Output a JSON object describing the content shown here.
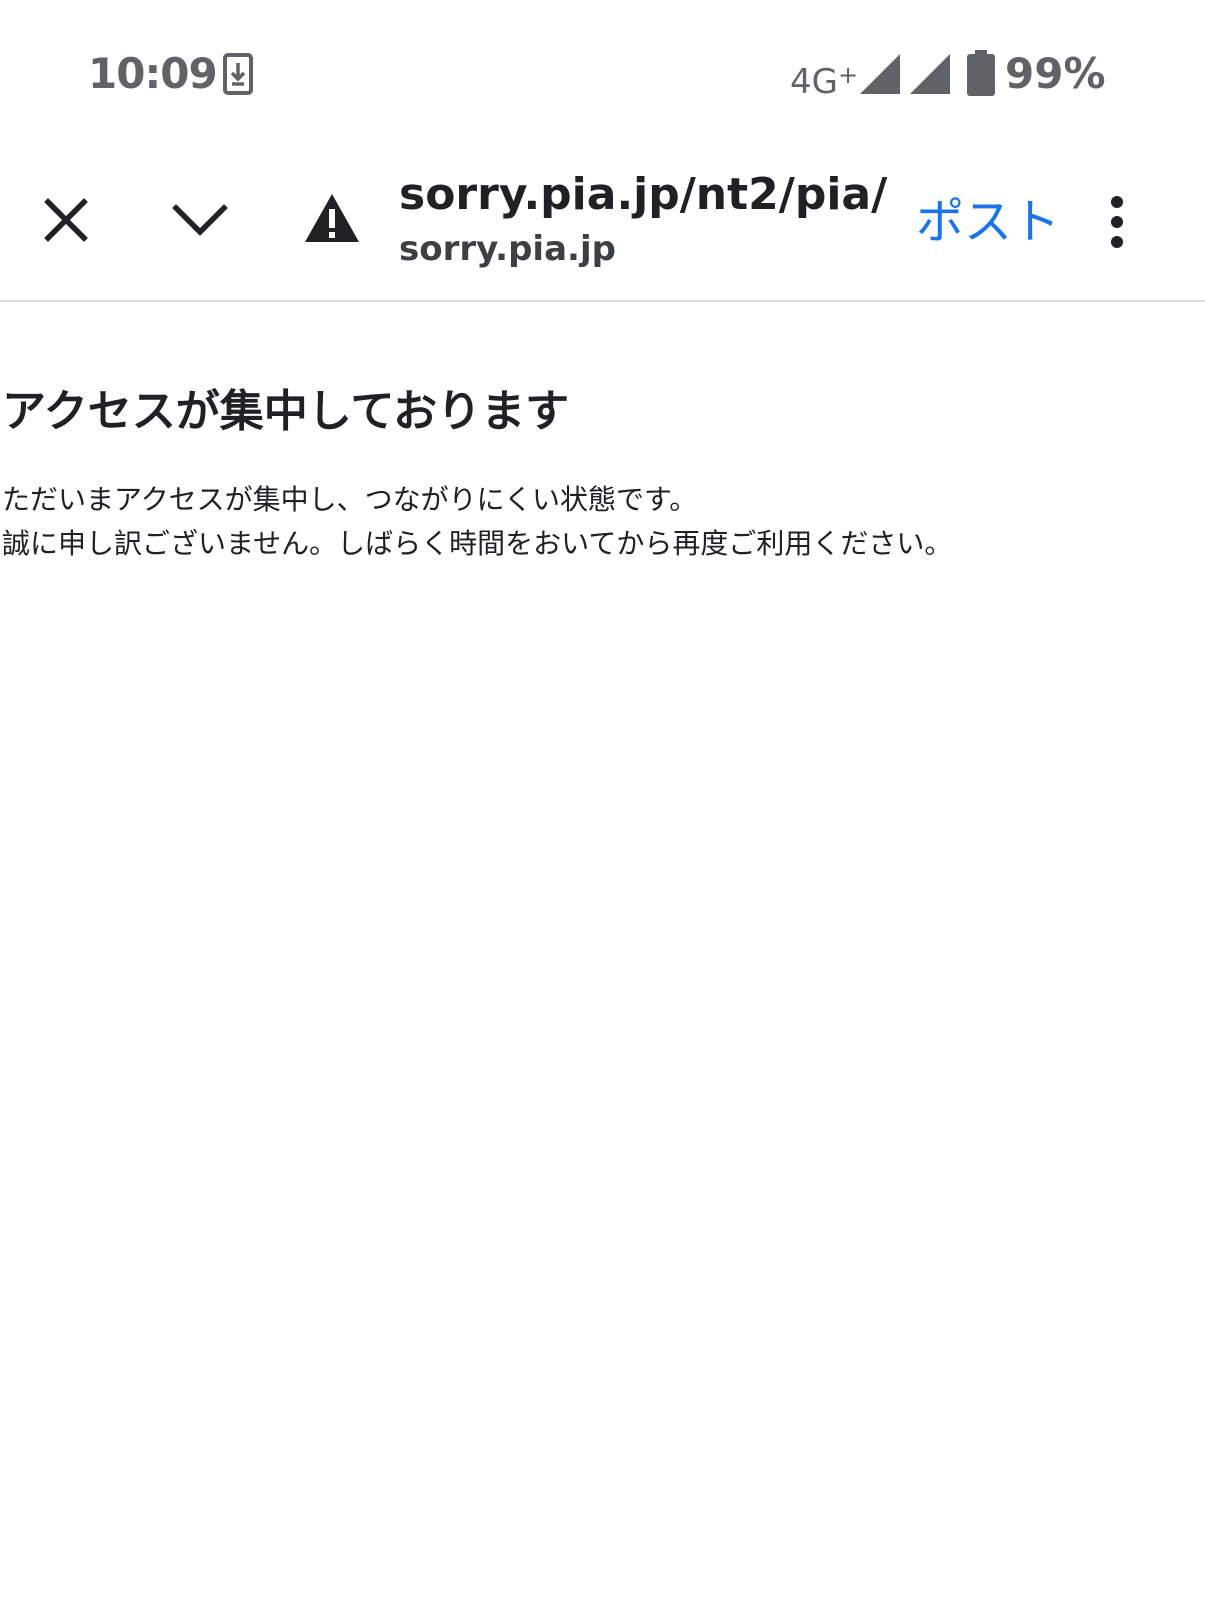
{
  "status_bar": {
    "time": "10:09",
    "network": "4G",
    "network_suffix": "+",
    "battery": "99%",
    "icons": [
      "download-notification-icon",
      "signal-icon",
      "signal-icon",
      "battery-icon"
    ]
  },
  "toolbar": {
    "url": "sorry.pia.jp/nt2/pia/",
    "host": "sorry.pia.jp",
    "post_label": "ポスト",
    "icons": [
      "close-icon",
      "chevron-down-icon",
      "warning-icon",
      "more-vert-icon"
    ],
    "accent_color": "#1a73e8"
  },
  "page": {
    "heading": "アクセスが集中しております",
    "message_lines": [
      "ただいまアクセスが集中し、つながりにくい状態です。",
      "誠に申し訳ございません。しばらく時間をおいてから再度ご利用ください。"
    ]
  }
}
